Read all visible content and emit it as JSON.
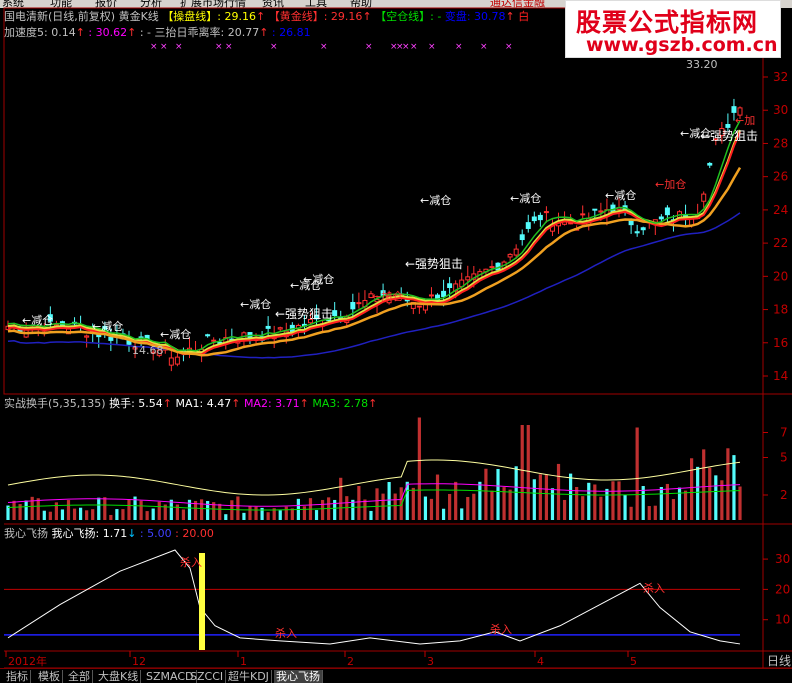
{
  "menu": [
    "系统",
    "功能",
    "报价",
    "分析",
    "扩展市场行情",
    "资讯",
    "工具",
    "帮助"
  ],
  "menu_right": "通达信金融",
  "watermark": {
    "title": "股票公式指标网",
    "url": "www.gszb.com.cn"
  },
  "main_header": {
    "stock": "国电清新(日线,前复权)",
    "indicator": "黄金K线",
    "items": [
      {
        "label": "【操盘线】",
        "value": ": 29.16",
        "color": "#ffff00",
        "arrow": "↑"
      },
      {
        "label": "【黄金线】",
        "value": ": 29.16",
        "color": "#ff3030",
        "arrow": "↑"
      },
      {
        "label": "【空仓线】",
        "value": ": -",
        "color": "#00e000"
      },
      {
        "label": "变盘",
        "value": ": 30.78",
        "color": "#0000ff",
        "arrow": "↑"
      },
      {
        "label": "白",
        "value": "",
        "color": "#ff2020"
      }
    ],
    "line2": [
      {
        "text": "加速度5: 0.14",
        "color": "#c0c0c0",
        "arrow": "↑"
      },
      {
        "text": ": 30.62",
        "color": "#ff00ff",
        "arrow": "↑"
      },
      {
        "text": ": - 三抬日乖离率: 20.77",
        "color": "#c0c0c0",
        "arrow": "↑"
      },
      {
        "text": ": 26.81",
        "color": "#0000ff"
      }
    ]
  },
  "main_axis": [
    "32",
    "30",
    "28",
    "26",
    "24",
    "22",
    "20",
    "18",
    "16",
    "14"
  ],
  "main_annotations": {
    "high": "33.20",
    "low": "14.68",
    "reduce": "←减仓",
    "strong": "←强势狙击",
    "add": "←加仓",
    "add_right": "←加"
  },
  "turnover_header": {
    "name": "实战换手(5,35,135)",
    "hs": "换手: 5.54",
    "ma1": "MA1: 4.47",
    "ma2": "MA2: 3.71",
    "ma3": "MA3: 2.78"
  },
  "turnover_axis": [
    "7",
    "5",
    "2"
  ],
  "fly_header": {
    "name": "我心飞扬",
    "value": "我心飞扬: 1.71",
    "p1": ": 5.00",
    "p2": ": 20.00"
  },
  "fly_axis": [
    "30",
    "20",
    "10"
  ],
  "fly_annotations": {
    "sell": "杀入",
    "buy": "杀入"
  },
  "date_axis": [
    "2012年",
    "12",
    "1",
    "2",
    "3",
    "4",
    "5"
  ],
  "date_axis_right": "日线",
  "tabs": [
    "指标",
    "模板",
    "全部",
    "大盘K线",
    "SZMACD",
    "SZCCI",
    "超牛KDJ",
    "我心飞扬"
  ],
  "active_tab": "我心飞扬"
}
